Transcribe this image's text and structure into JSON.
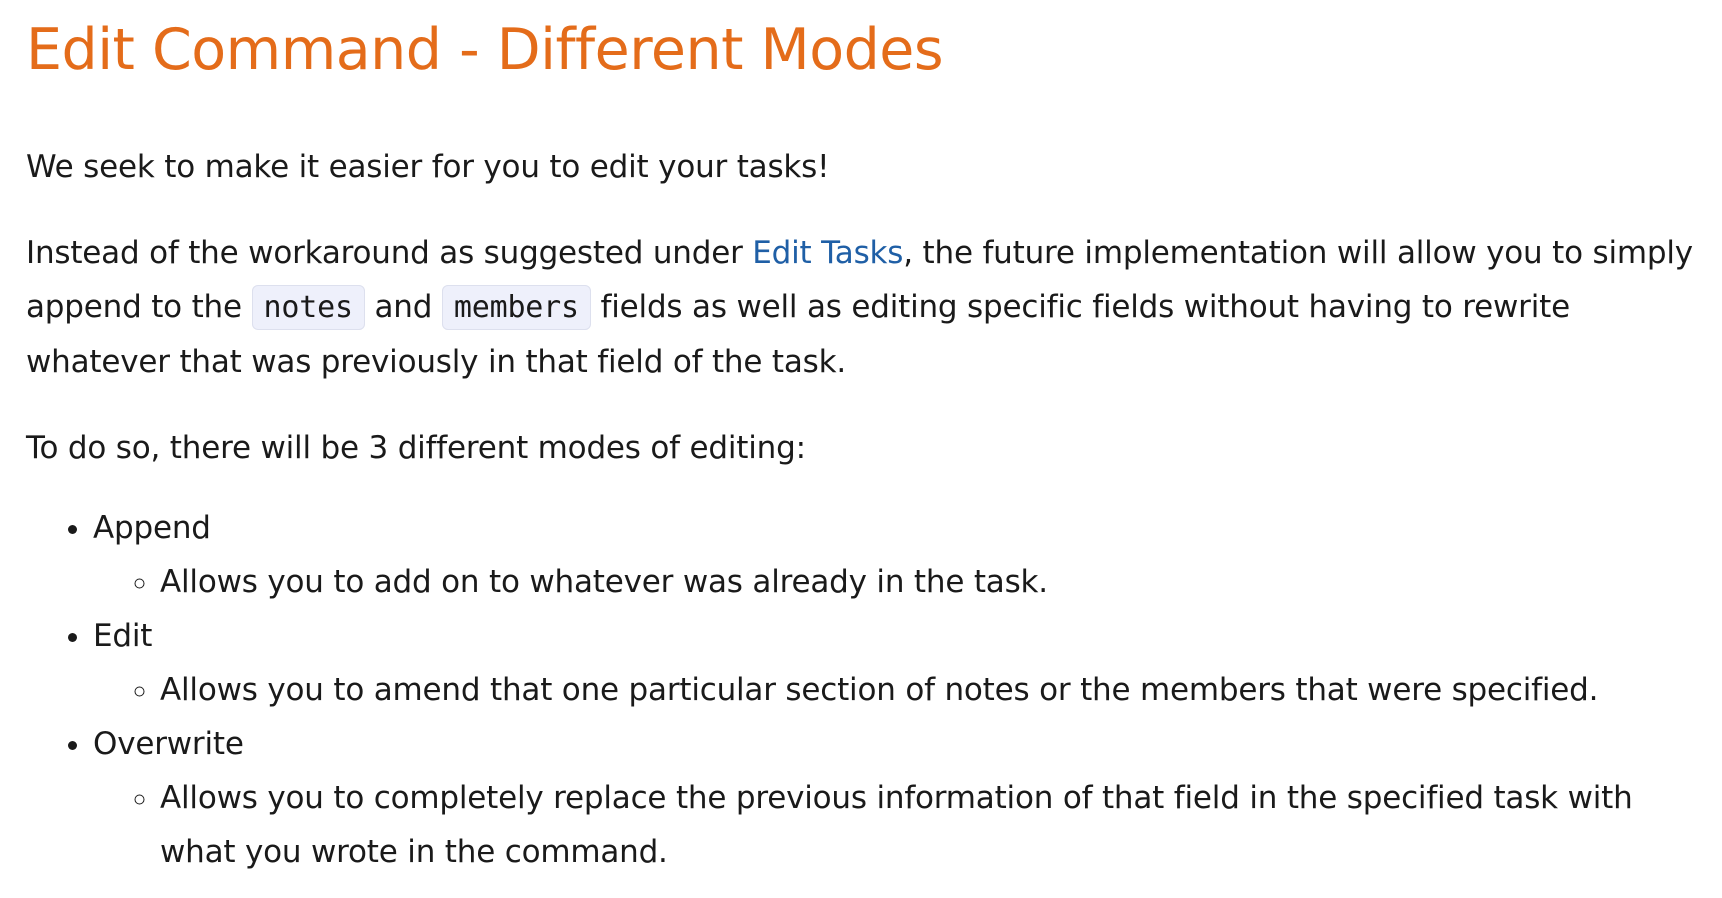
{
  "title": "Edit Command - Different Modes",
  "intro": "We seek to make it easier for you to edit your tasks!",
  "details": {
    "before_link": "Instead of the workaround as suggested under ",
    "link_text": "Edit Tasks",
    "after_link": ", the future implementation will allow you to simply append to the ",
    "code_notes": "notes",
    "and_text": " and ",
    "code_members": "members",
    "tail": " fields as well as editing specific fields without having to rewrite whatever that was previously in that field of the task."
  },
  "modes_intro": "To do so, there will be 3 different modes of editing:",
  "modes": [
    {
      "name": "Append",
      "description": "Allows you to add on to whatever was already in the task."
    },
    {
      "name": "Edit",
      "description": "Allows you to amend that one particular section of notes or the members that were specified."
    },
    {
      "name": "Overwrite",
      "description": "Allows you to completely replace the previous information of that field in the specified task with what you wrote in the command."
    }
  ],
  "colors": {
    "title": "#e46c1a",
    "link": "#1f5fa6",
    "code_background": "#eef0fb"
  }
}
